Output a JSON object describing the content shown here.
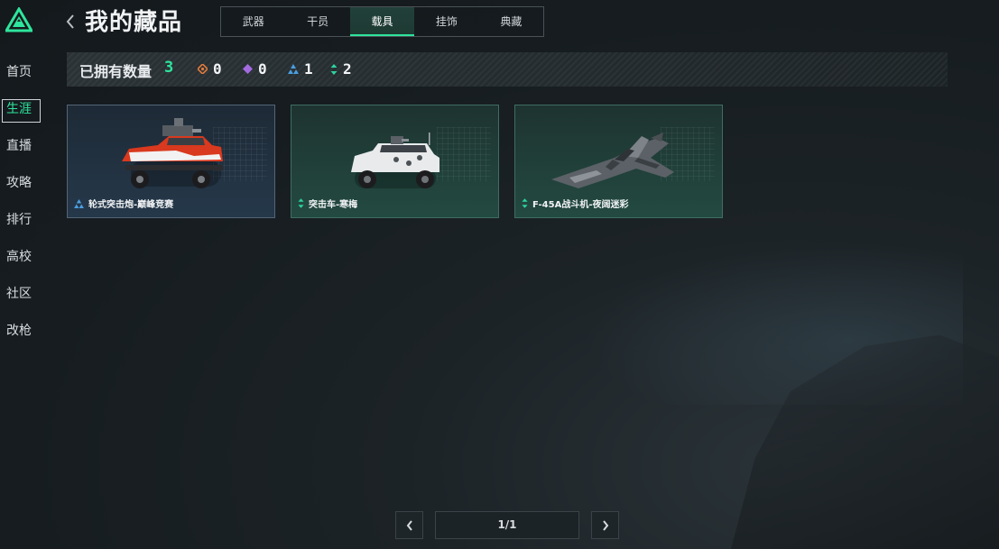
{
  "app": {
    "page_title": "我的藏品"
  },
  "sidebar": {
    "items": [
      {
        "label": "首页"
      },
      {
        "label": "生涯",
        "active": true
      },
      {
        "label": "直播"
      },
      {
        "label": "攻略"
      },
      {
        "label": "排行"
      },
      {
        "label": "高校"
      },
      {
        "label": "社区"
      },
      {
        "label": "改枪"
      }
    ]
  },
  "tabs": [
    {
      "label": "武器"
    },
    {
      "label": "干员"
    },
    {
      "label": "载具",
      "active": true
    },
    {
      "label": "挂饰"
    },
    {
      "label": "典藏"
    }
  ],
  "stats": {
    "label": "已拥有数量",
    "total": "3",
    "rarities": [
      {
        "icon": "orange-diamond-icon",
        "color": "#e07a3a",
        "count": "0"
      },
      {
        "icon": "purple-diamond-icon",
        "color": "#a46be0",
        "count": "0"
      },
      {
        "icon": "blue-triangle-icon",
        "color": "#4a9ee0",
        "count": "1"
      },
      {
        "icon": "green-arrows-icon",
        "color": "#2ed3a0",
        "count": "2"
      }
    ]
  },
  "cards": [
    {
      "name": "轮式突击炮-巅峰竞赛",
      "rarity": "blue",
      "icon": "blue-triangle-icon"
    },
    {
      "name": "突击车-寒梅",
      "rarity": "green",
      "icon": "green-arrows-icon"
    },
    {
      "name": "F-45A战斗机-夜阔迷彩",
      "rarity": "green",
      "icon": "green-arrows-icon"
    }
  ],
  "pagination": {
    "prev": "‹",
    "next": "›",
    "page": "1/1"
  },
  "colors": {
    "accent": "#2ee59d",
    "rarity_blue": "#4a9ee0",
    "rarity_green": "#2ed3a0"
  }
}
